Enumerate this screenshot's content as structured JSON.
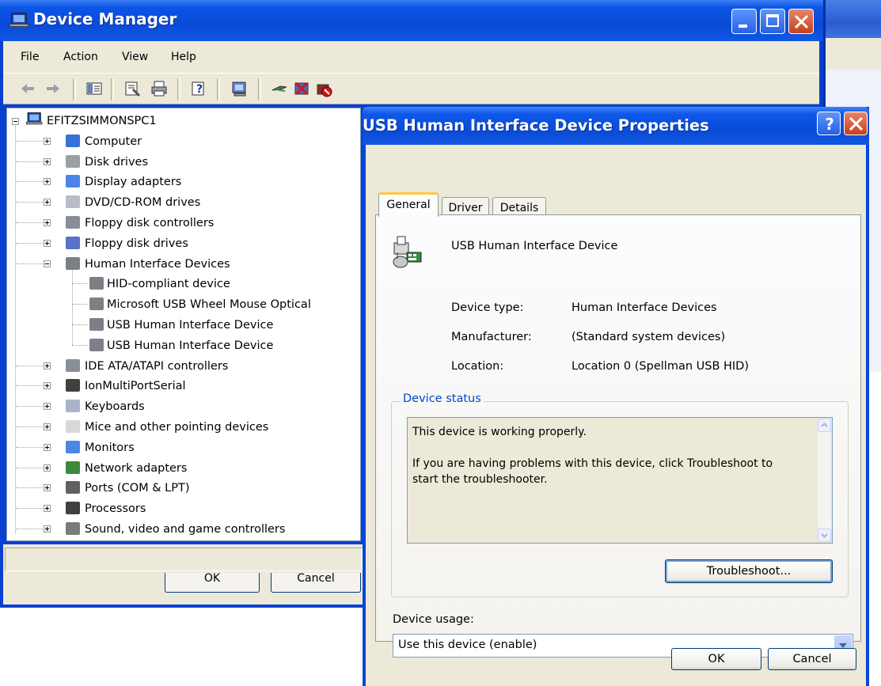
{
  "device_manager": {
    "title": "Device Manager",
    "menu": [
      "File",
      "Action",
      "View",
      "Help"
    ],
    "tree": {
      "root": "EFITZSIMMONSPC1",
      "items": [
        {
          "label": "Computer",
          "icon": "computer-icon",
          "color": "#3a70d8"
        },
        {
          "label": "Disk drives",
          "icon": "disk-drive-icon",
          "color": "#9aa0a8"
        },
        {
          "label": "Display adapters",
          "icon": "display-adapter-icon",
          "color": "#4a86e8"
        },
        {
          "label": "DVD/CD-ROM drives",
          "icon": "dvd-drive-icon",
          "color": "#b8bcc6"
        },
        {
          "label": "Floppy disk controllers",
          "icon": "floppy-controller-icon",
          "color": "#8a8e96"
        },
        {
          "label": "Floppy disk drives",
          "icon": "floppy-drive-icon",
          "color": "#5a72c8"
        },
        {
          "label": "Human Interface Devices",
          "icon": "hid-icon",
          "color": "#7c8086",
          "expanded": true,
          "children": [
            "HID-compliant device",
            "Microsoft USB Wheel Mouse Optical",
            "USB Human Interface Device",
            "USB Human Interface Device"
          ]
        },
        {
          "label": "IDE ATA/ATAPI controllers",
          "icon": "ide-controller-icon",
          "color": "#8a8e96"
        },
        {
          "label": "IonMultiPortSerial",
          "icon": "serial-port-icon",
          "color": "#404040"
        },
        {
          "label": "Keyboards",
          "icon": "keyboard-icon",
          "color": "#aab4c8"
        },
        {
          "label": "Mice and other pointing devices",
          "icon": "mouse-icon",
          "color": "#d8d8d8"
        },
        {
          "label": "Monitors",
          "icon": "monitor-icon",
          "color": "#4a86e8"
        },
        {
          "label": "Network adapters",
          "icon": "network-adapter-icon",
          "color": "#3c8a3c"
        },
        {
          "label": "Ports (COM & LPT)",
          "icon": "ports-icon",
          "color": "#606060"
        },
        {
          "label": "Processors",
          "icon": "processor-icon",
          "color": "#404040"
        },
        {
          "label": "Sound, video and game controllers",
          "icon": "sound-icon",
          "color": "#7a7a7a"
        }
      ]
    },
    "ghost_buttons": [
      "OK",
      "Cancel"
    ]
  },
  "properties": {
    "title": "USB Human Interface Device Properties",
    "tabs": [
      "General",
      "Driver",
      "Details"
    ],
    "device_name": "USB Human Interface Device",
    "info": [
      {
        "label": "Device type:",
        "value": "Human Interface Devices"
      },
      {
        "label": "Manufacturer:",
        "value": "(Standard system devices)"
      },
      {
        "label": "Location:",
        "value": "Location 0 (Spellman USB HID)"
      }
    ],
    "status_group": "Device status",
    "status_text": "This device is working properly.\n\nIf you are having problems with this device, click Troubleshoot to\nstart the troubleshooter.",
    "troubleshoot": "Troubleshoot...",
    "usage_label": "Device usage:",
    "usage_value": "Use this device (enable)",
    "ok": "OK",
    "cancel": "Cancel"
  },
  "colors": {
    "xp_title_blue": "#0a4bd8",
    "dialog_face": "#ece9d8",
    "group_title": "#0046d5"
  }
}
